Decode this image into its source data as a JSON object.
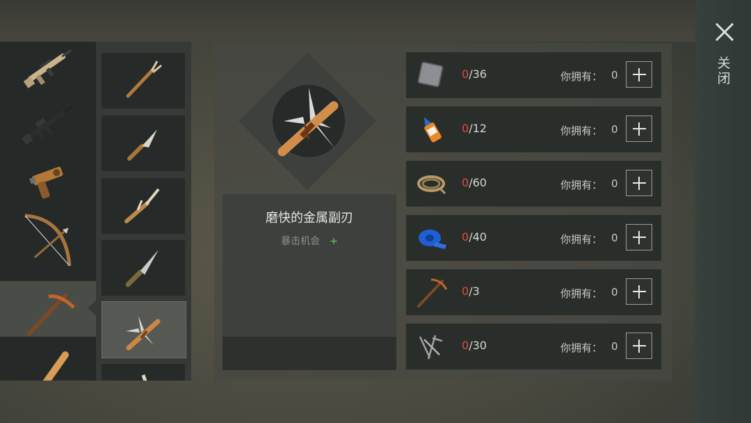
{
  "close": {
    "label": "关闭",
    "icon": "close-icon"
  },
  "categories": [
    {
      "name": "scar-rifle-icon"
    },
    {
      "name": "m16-rifle-icon"
    },
    {
      "name": "flare-pistol-icon"
    },
    {
      "name": "bow-icon"
    },
    {
      "name": "pickaxe-icon",
      "selected": true
    },
    {
      "name": "bat-icon"
    }
  ],
  "items": [
    {
      "name": "bone-spear-icon"
    },
    {
      "name": "bone-knife-icon"
    },
    {
      "name": "bone-shiv-icon"
    },
    {
      "name": "combat-knife-icon"
    },
    {
      "name": "metal-blade-icon",
      "selected": true
    },
    {
      "name": "bone-club-icon"
    }
  ],
  "selected_item": {
    "name": "磨快的金属副刃",
    "stat_label": "暴击机会",
    "stat_value": "+"
  },
  "requirements": [
    {
      "icon": "metal-plate-icon",
      "have": "0",
      "need": "/36",
      "own_label": "你拥有：",
      "own_value": "0"
    },
    {
      "icon": "glue-icon",
      "have": "0",
      "need": "/12",
      "own_label": "你拥有：",
      "own_value": "0"
    },
    {
      "icon": "rope-icon",
      "have": "0",
      "need": "/60",
      "own_label": "你拥有：",
      "own_value": "0"
    },
    {
      "icon": "tape-icon",
      "have": "0",
      "need": "/40",
      "own_label": "你拥有：",
      "own_value": "0"
    },
    {
      "icon": "pickaxe-blueprint-icon",
      "have": "0",
      "need": "/3",
      "own_label": "你拥有：",
      "own_value": "0"
    },
    {
      "icon": "nails-icon",
      "have": "0",
      "need": "/30",
      "own_label": "你拥有：",
      "own_value": "0"
    }
  ],
  "colors": {
    "missing": "#e04a3c",
    "stat_plus": "#5bd36a"
  }
}
